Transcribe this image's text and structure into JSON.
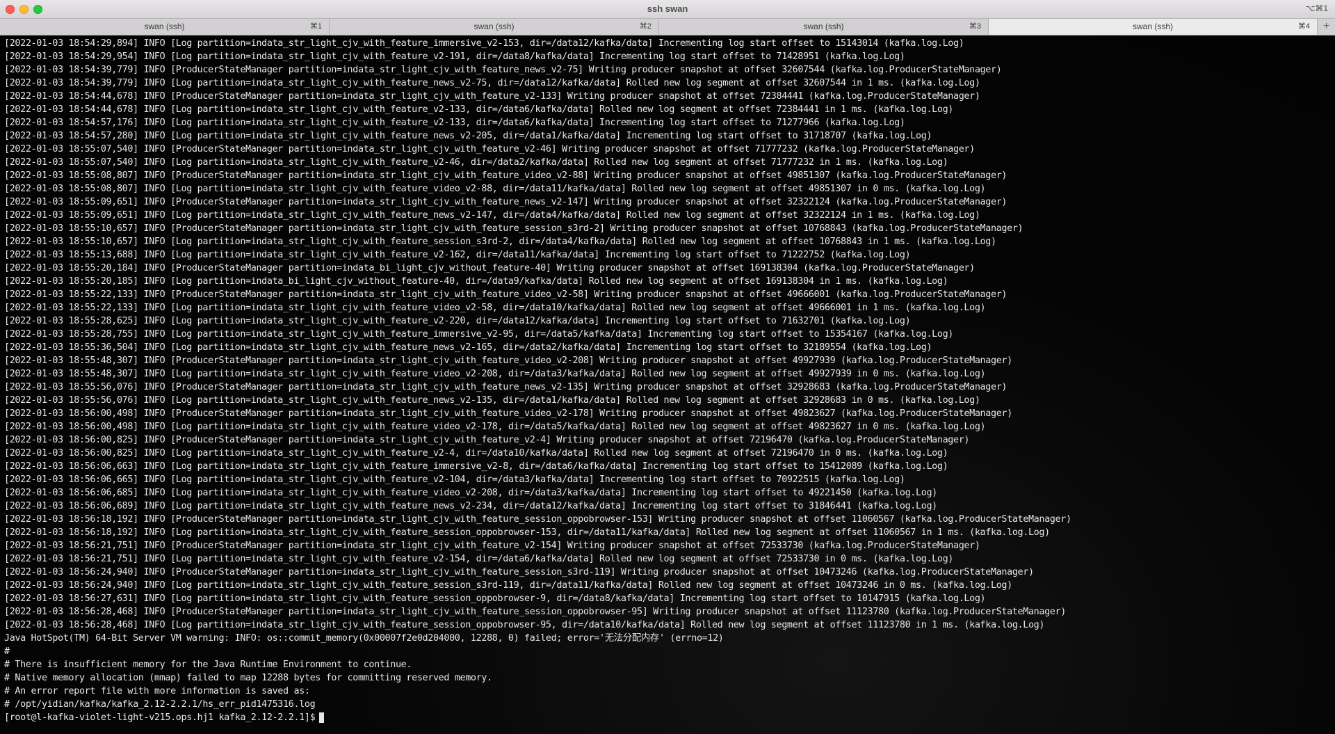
{
  "window": {
    "title": "ssh swan",
    "shortcut": "⌥⌘1"
  },
  "tabs": [
    {
      "label": "swan (ssh)",
      "key": "⌘1",
      "active": false
    },
    {
      "label": "swan (ssh)",
      "key": "⌘2",
      "active": false
    },
    {
      "label": "swan (ssh)",
      "key": "⌘3",
      "active": false
    },
    {
      "label": "swan (ssh)",
      "key": "⌘4",
      "active": true
    }
  ],
  "add_tab_label": "+",
  "terminal": {
    "lines": [
      "[2022-01-03 18:54:29,894] INFO [Log partition=indata_str_light_cjv_with_feature_immersive_v2-153, dir=/data12/kafka/data] Incrementing log start offset to 15143014 (kafka.log.Log)",
      "[2022-01-03 18:54:29,954] INFO [Log partition=indata_str_light_cjv_with_feature_v2-191, dir=/data8/kafka/data] Incrementing log start offset to 71428951 (kafka.log.Log)",
      "[2022-01-03 18:54:39,779] INFO [ProducerStateManager partition=indata_str_light_cjv_with_feature_news_v2-75] Writing producer snapshot at offset 32607544 (kafka.log.ProducerStateManager)",
      "[2022-01-03 18:54:39,779] INFO [Log partition=indata_str_light_cjv_with_feature_news_v2-75, dir=/data12/kafka/data] Rolled new log segment at offset 32607544 in 1 ms. (kafka.log.Log)",
      "[2022-01-03 18:54:44,678] INFO [ProducerStateManager partition=indata_str_light_cjv_with_feature_v2-133] Writing producer snapshot at offset 72384441 (kafka.log.ProducerStateManager)",
      "[2022-01-03 18:54:44,678] INFO [Log partition=indata_str_light_cjv_with_feature_v2-133, dir=/data6/kafka/data] Rolled new log segment at offset 72384441 in 1 ms. (kafka.log.Log)",
      "[2022-01-03 18:54:57,176] INFO [Log partition=indata_str_light_cjv_with_feature_v2-133, dir=/data6/kafka/data] Incrementing log start offset to 71277966 (kafka.log.Log)",
      "[2022-01-03 18:54:57,280] INFO [Log partition=indata_str_light_cjv_with_feature_news_v2-205, dir=/data1/kafka/data] Incrementing log start offset to 31718707 (kafka.log.Log)",
      "[2022-01-03 18:55:07,540] INFO [ProducerStateManager partition=indata_str_light_cjv_with_feature_v2-46] Writing producer snapshot at offset 71777232 (kafka.log.ProducerStateManager)",
      "[2022-01-03 18:55:07,540] INFO [Log partition=indata_str_light_cjv_with_feature_v2-46, dir=/data2/kafka/data] Rolled new log segment at offset 71777232 in 1 ms. (kafka.log.Log)",
      "[2022-01-03 18:55:08,807] INFO [ProducerStateManager partition=indata_str_light_cjv_with_feature_video_v2-88] Writing producer snapshot at offset 49851307 (kafka.log.ProducerStateManager)",
      "[2022-01-03 18:55:08,807] INFO [Log partition=indata_str_light_cjv_with_feature_video_v2-88, dir=/data11/kafka/data] Rolled new log segment at offset 49851307 in 0 ms. (kafka.log.Log)",
      "[2022-01-03 18:55:09,651] INFO [ProducerStateManager partition=indata_str_light_cjv_with_feature_news_v2-147] Writing producer snapshot at offset 32322124 (kafka.log.ProducerStateManager)",
      "[2022-01-03 18:55:09,651] INFO [Log partition=indata_str_light_cjv_with_feature_news_v2-147, dir=/data4/kafka/data] Rolled new log segment at offset 32322124 in 1 ms. (kafka.log.Log)",
      "[2022-01-03 18:55:10,657] INFO [ProducerStateManager partition=indata_str_light_cjv_with_feature_session_s3rd-2] Writing producer snapshot at offset 10768843 (kafka.log.ProducerStateManager)",
      "[2022-01-03 18:55:10,657] INFO [Log partition=indata_str_light_cjv_with_feature_session_s3rd-2, dir=/data4/kafka/data] Rolled new log segment at offset 10768843 in 1 ms. (kafka.log.Log)",
      "[2022-01-03 18:55:13,688] INFO [Log partition=indata_str_light_cjv_with_feature_v2-162, dir=/data11/kafka/data] Incrementing log start offset to 71222752 (kafka.log.Log)",
      "[2022-01-03 18:55:20,184] INFO [ProducerStateManager partition=indata_bi_light_cjv_without_feature-40] Writing producer snapshot at offset 169138304 (kafka.log.ProducerStateManager)",
      "[2022-01-03 18:55:20,185] INFO [Log partition=indata_bi_light_cjv_without_feature-40, dir=/data9/kafka/data] Rolled new log segment at offset 169138304 in 1 ms. (kafka.log.Log)",
      "[2022-01-03 18:55:22,133] INFO [ProducerStateManager partition=indata_str_light_cjv_with_feature_video_v2-58] Writing producer snapshot at offset 49666001 (kafka.log.ProducerStateManager)",
      "[2022-01-03 18:55:22,133] INFO [Log partition=indata_str_light_cjv_with_feature_video_v2-58, dir=/data10/kafka/data] Rolled new log segment at offset 49666001 in 1 ms. (kafka.log.Log)",
      "[2022-01-03 18:55:28,625] INFO [Log partition=indata_str_light_cjv_with_feature_v2-220, dir=/data12/kafka/data] Incrementing log start offset to 71632701 (kafka.log.Log)",
      "[2022-01-03 18:55:28,755] INFO [Log partition=indata_str_light_cjv_with_feature_immersive_v2-95, dir=/data5/kafka/data] Incrementing log start offset to 15354167 (kafka.log.Log)",
      "[2022-01-03 18:55:36,504] INFO [Log partition=indata_str_light_cjv_with_feature_news_v2-165, dir=/data2/kafka/data] Incrementing log start offset to 32189554 (kafka.log.Log)",
      "[2022-01-03 18:55:48,307] INFO [ProducerStateManager partition=indata_str_light_cjv_with_feature_video_v2-208] Writing producer snapshot at offset 49927939 (kafka.log.ProducerStateManager)",
      "[2022-01-03 18:55:48,307] INFO [Log partition=indata_str_light_cjv_with_feature_video_v2-208, dir=/data3/kafka/data] Rolled new log segment at offset 49927939 in 0 ms. (kafka.log.Log)",
      "[2022-01-03 18:55:56,076] INFO [ProducerStateManager partition=indata_str_light_cjv_with_feature_news_v2-135] Writing producer snapshot at offset 32928683 (kafka.log.ProducerStateManager)",
      "[2022-01-03 18:55:56,076] INFO [Log partition=indata_str_light_cjv_with_feature_news_v2-135, dir=/data1/kafka/data] Rolled new log segment at offset 32928683 in 0 ms. (kafka.log.Log)",
      "[2022-01-03 18:56:00,498] INFO [ProducerStateManager partition=indata_str_light_cjv_with_feature_video_v2-178] Writing producer snapshot at offset 49823627 (kafka.log.ProducerStateManager)",
      "[2022-01-03 18:56:00,498] INFO [Log partition=indata_str_light_cjv_with_feature_video_v2-178, dir=/data5/kafka/data] Rolled new log segment at offset 49823627 in 0 ms. (kafka.log.Log)",
      "[2022-01-03 18:56:00,825] INFO [ProducerStateManager partition=indata_str_light_cjv_with_feature_v2-4] Writing producer snapshot at offset 72196470 (kafka.log.ProducerStateManager)",
      "[2022-01-03 18:56:00,825] INFO [Log partition=indata_str_light_cjv_with_feature_v2-4, dir=/data10/kafka/data] Rolled new log segment at offset 72196470 in 0 ms. (kafka.log.Log)",
      "[2022-01-03 18:56:06,663] INFO [Log partition=indata_str_light_cjv_with_feature_immersive_v2-8, dir=/data6/kafka/data] Incrementing log start offset to 15412089 (kafka.log.Log)",
      "[2022-01-03 18:56:06,665] INFO [Log partition=indata_str_light_cjv_with_feature_v2-104, dir=/data3/kafka/data] Incrementing log start offset to 70922515 (kafka.log.Log)",
      "[2022-01-03 18:56:06,685] INFO [Log partition=indata_str_light_cjv_with_feature_video_v2-208, dir=/data3/kafka/data] Incrementing log start offset to 49221450 (kafka.log.Log)",
      "[2022-01-03 18:56:06,689] INFO [Log partition=indata_str_light_cjv_with_feature_news_v2-234, dir=/data12/kafka/data] Incrementing log start offset to 31846441 (kafka.log.Log)",
      "[2022-01-03 18:56:18,192] INFO [ProducerStateManager partition=indata_str_light_cjv_with_feature_session_oppobrowser-153] Writing producer snapshot at offset 11060567 (kafka.log.ProducerStateManager)",
      "[2022-01-03 18:56:18,192] INFO [Log partition=indata_str_light_cjv_with_feature_session_oppobrowser-153, dir=/data11/kafka/data] Rolled new log segment at offset 11060567 in 1 ms. (kafka.log.Log)",
      "[2022-01-03 18:56:21,751] INFO [ProducerStateManager partition=indata_str_light_cjv_with_feature_v2-154] Writing producer snapshot at offset 72533730 (kafka.log.ProducerStateManager)",
      "[2022-01-03 18:56:21,751] INFO [Log partition=indata_str_light_cjv_with_feature_v2-154, dir=/data6/kafka/data] Rolled new log segment at offset 72533730 in 0 ms. (kafka.log.Log)",
      "[2022-01-03 18:56:24,940] INFO [ProducerStateManager partition=indata_str_light_cjv_with_feature_session_s3rd-119] Writing producer snapshot at offset 10473246 (kafka.log.ProducerStateManager)",
      "[2022-01-03 18:56:24,940] INFO [Log partition=indata_str_light_cjv_with_feature_session_s3rd-119, dir=/data11/kafka/data] Rolled new log segment at offset 10473246 in 0 ms. (kafka.log.Log)",
      "[2022-01-03 18:56:27,631] INFO [Log partition=indata_str_light_cjv_with_feature_session_oppobrowser-9, dir=/data8/kafka/data] Incrementing log start offset to 10147915 (kafka.log.Log)",
      "[2022-01-03 18:56:28,468] INFO [ProducerStateManager partition=indata_str_light_cjv_with_feature_session_oppobrowser-95] Writing producer snapshot at offset 11123780 (kafka.log.ProducerStateManager)",
      "[2022-01-03 18:56:28,468] INFO [Log partition=indata_str_light_cjv_with_feature_session_oppobrowser-95, dir=/data10/kafka/data] Rolled new log segment at offset 11123780 in 1 ms. (kafka.log.Log)",
      "Java HotSpot(TM) 64-Bit Server VM warning: INFO: os::commit_memory(0x00007f2e0d204000, 12288, 0) failed; error='无法分配内存' (errno=12)",
      "#",
      "# There is insufficient memory for the Java Runtime Environment to continue.",
      "# Native memory allocation (mmap) failed to map 12288 bytes for committing reserved memory.",
      "# An error report file with more information is saved as:",
      "# /opt/yidian/kafka/kafka_2.12-2.2.1/hs_err_pid1475316.log"
    ],
    "prompt": "[root@l-kafka-violet-light-v215.ops.hj1 kafka_2.12-2.2.1]$"
  }
}
